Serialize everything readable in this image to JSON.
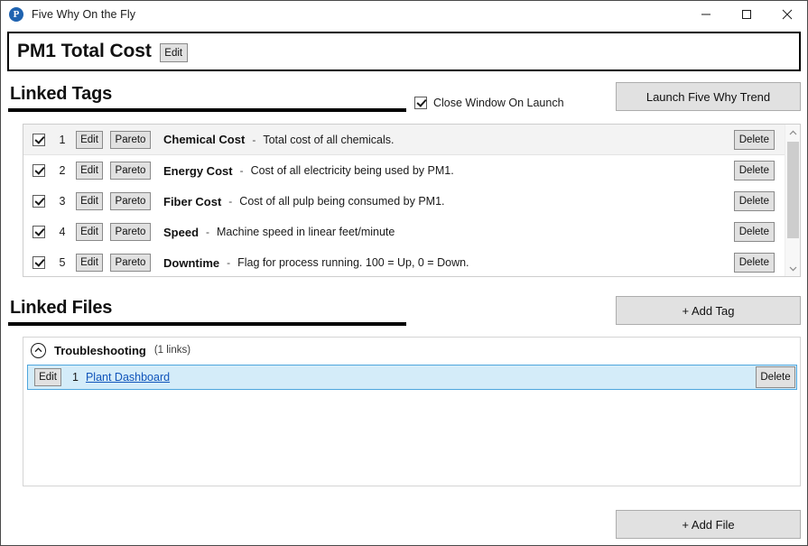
{
  "window": {
    "app_icon": "app-logo-p-icon",
    "title": "Five Why On the Fly",
    "minimize_label": "minimize-icon",
    "maximize_label": "maximize-icon",
    "close_label": "close-icon"
  },
  "header": {
    "title": "PM1 Total Cost",
    "edit_label": "Edit"
  },
  "linked_tags": {
    "heading": "Linked Tags",
    "close_on_launch": {
      "label": "Close Window On Launch",
      "checked": true
    },
    "launch_button": "Launch Five Why Trend",
    "add_tag_button": "+ Add Tag",
    "row_buttons": {
      "edit": "Edit",
      "pareto": "Pareto",
      "delete": "Delete"
    },
    "separator": "-",
    "rows": [
      {
        "index": "1",
        "checked": true,
        "name": "Chemical Cost",
        "description": "Total cost of all chemicals."
      },
      {
        "index": "2",
        "checked": true,
        "name": "Energy Cost",
        "description": "Cost of all electricity being used by PM1."
      },
      {
        "index": "3",
        "checked": true,
        "name": "Fiber Cost",
        "description": "Cost of all pulp being consumed by PM1."
      },
      {
        "index": "4",
        "checked": true,
        "name": "Speed",
        "description": "Machine speed in linear feet/minute"
      },
      {
        "index": "5",
        "checked": true,
        "name": "Downtime",
        "description": "Flag for process running.  100 = Up, 0 = Down."
      }
    ]
  },
  "linked_files": {
    "heading": "Linked Files",
    "add_file_button": "+ Add File",
    "group": {
      "name": "Troubleshooting",
      "count": "(1 links)",
      "collapse_icon": "chevron-up-circle-icon"
    },
    "rows": [
      {
        "index": "1",
        "edit_label": "Edit",
        "link_text": "Plant Dashboard",
        "delete_label": "Delete",
        "selected": true
      }
    ]
  },
  "colors": {
    "accent_blue": "#1f63b0",
    "link_blue": "#1155bb",
    "selection_fill": "#d4ecf9",
    "selection_border": "#4ea6dd",
    "button_face": "#e1e1e1"
  }
}
